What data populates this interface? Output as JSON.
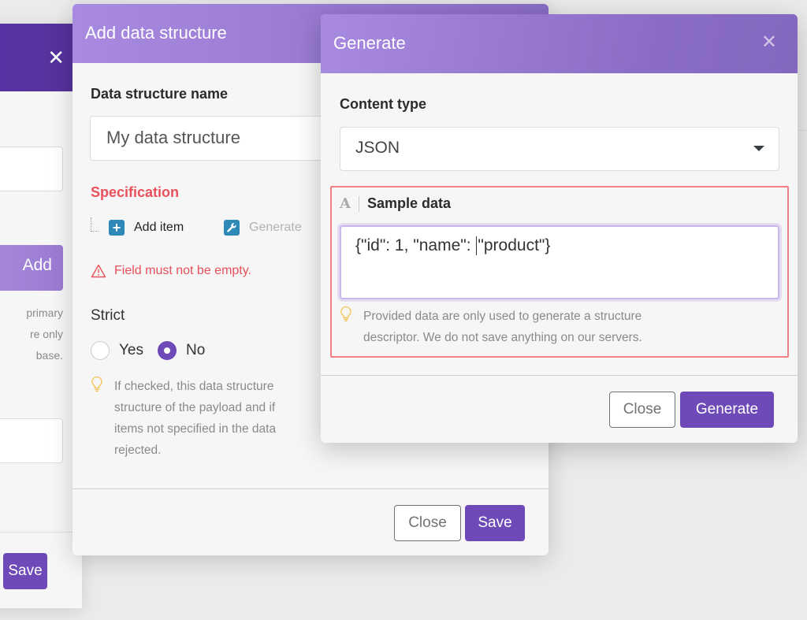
{
  "background_panel": {
    "add_label": "Add",
    "help_text": "primary\nre only\nbase.",
    "save_label": "Save"
  },
  "add_data_structure": {
    "title": "Add data structure",
    "name_label": "Data structure name",
    "name_value": "My data structure",
    "spec_label": "Specification",
    "add_item_label": "Add item",
    "generate_label": "Generate",
    "error_text": "Field must not be empty.",
    "strict_label": "Strict",
    "strict_options": [
      {
        "label": "Yes",
        "checked": false
      },
      {
        "label": "No",
        "checked": true
      }
    ],
    "strict_hint": "If checked, this data structure\nstructure of the payload and if\nitems not specified in the data\nrejected.",
    "close_label": "Close",
    "save_label": "Save"
  },
  "generate_modal": {
    "title": "Generate",
    "content_type_label": "Content type",
    "content_type_value": "JSON",
    "sample_data_label": "Sample data",
    "sample_data_type_icon": "A",
    "sample_data_before_cursor": "{\"id\": 1, \"name\": ",
    "sample_data_after_cursor": "\"product\"}",
    "hint_text": "Provided data are only used to generate a structure\ndescriptor. We do not save anything on our servers.",
    "close_label": "Close",
    "generate_label": "Generate"
  },
  "colors": {
    "accent": "#6e4ab8",
    "header_gradient_start": "#a88ae0",
    "header_gradient_end": "#8a6cc6",
    "error": "#e8505b",
    "hint_icon": "#f5c04a"
  }
}
